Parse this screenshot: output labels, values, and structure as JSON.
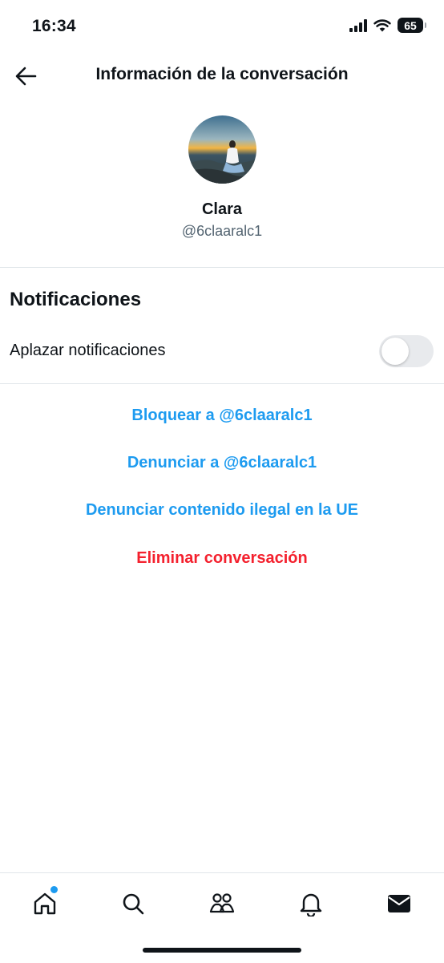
{
  "status_bar": {
    "time": "16:34",
    "battery": "65"
  },
  "header": {
    "title": "Información de la conversación",
    "back_icon": "arrow-left-icon"
  },
  "profile": {
    "name": "Clara",
    "handle": "@6claaralc1"
  },
  "notifications": {
    "section_title": "Notificaciones",
    "snooze_label": "Aplazar notificaciones",
    "snooze_enabled": false
  },
  "actions": {
    "block": "Bloquear a @6claaralc1",
    "report": "Denunciar a @6claaralc1",
    "report_illegal": "Denunciar contenido ilegal en la UE",
    "delete": "Eliminar conversación"
  },
  "colors": {
    "link": "#1d9bf0",
    "danger": "#f4212e",
    "text": "#0f1419",
    "muted": "#536471"
  },
  "bottom_nav": {
    "items": [
      "home-icon",
      "search-icon",
      "communities-icon",
      "notifications-bell-icon",
      "messages-envelope-icon"
    ],
    "active": "messages-envelope-icon"
  }
}
